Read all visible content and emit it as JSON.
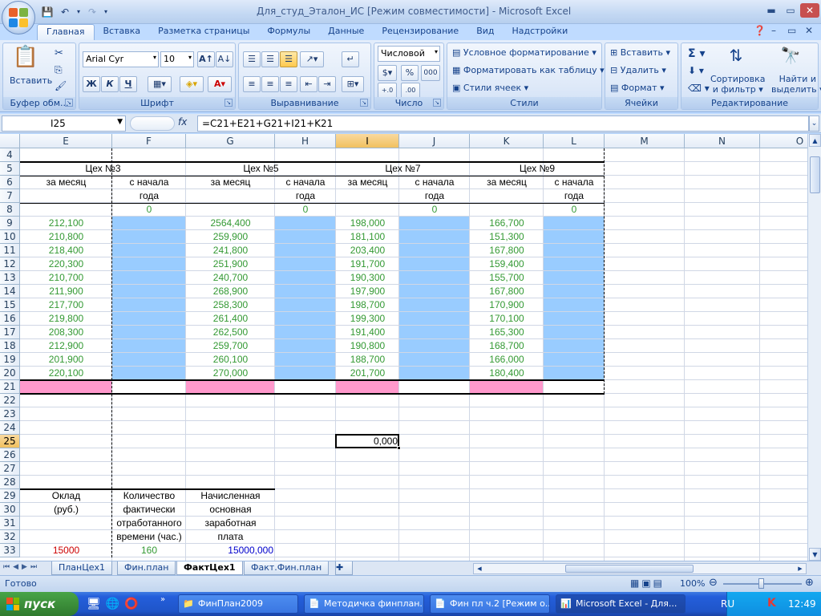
{
  "window": {
    "title": "Для_студ_Эталон_ИС  [Режим совместимости] - Microsoft Excel",
    "min": "▭",
    "close": "✕"
  },
  "ribbon_tabs": [
    "Главная",
    "Вставка",
    "Разметка страницы",
    "Формулы",
    "Данные",
    "Рецензирование",
    "Вид",
    "Надстройки"
  ],
  "groups": {
    "clipboard": {
      "label": "Буфер обм...",
      "paste": "Вставить"
    },
    "font": {
      "label": "Шрифт",
      "font_name": "Arial Cyr",
      "font_size": "10",
      "bold": "Ж",
      "italic": "К",
      "underline": "Ч"
    },
    "alignment": {
      "label": "Выравнивание"
    },
    "number": {
      "label": "Число",
      "format": "Числовой",
      "percent": "%",
      "thousands": "000"
    },
    "styles": {
      "label": "Стили",
      "cond_format": "Условное форматирование",
      "format_table": "Форматировать как таблицу",
      "cell_styles": "Стили ячеек"
    },
    "cells": {
      "label": "Ячейки",
      "insert": "Вставить",
      "delete": "Удалить",
      "format": "Формат"
    },
    "editing": {
      "label": "Редактирование",
      "sigma": "Σ",
      "sort_line1": "Сортировка",
      "sort_line2": "и фильтр",
      "find_line1": "Найти и",
      "find_line2": "выделить"
    }
  },
  "formula_bar": {
    "name_box": "I25",
    "fx": "fx",
    "formula": "=C21+E21+G21+I21+K21"
  },
  "columns": [
    {
      "letter": "E"
    },
    {
      "letter": "F"
    },
    {
      "letter": "G"
    },
    {
      "letter": "H"
    },
    {
      "letter": "I"
    },
    {
      "letter": "J"
    },
    {
      "letter": "K"
    },
    {
      "letter": "L"
    },
    {
      "letter": "M"
    },
    {
      "letter": "N"
    },
    {
      "letter": "O"
    }
  ],
  "rows": [
    "4",
    "5",
    "6",
    "7",
    "8",
    "9",
    "10",
    "11",
    "12",
    "13",
    "14",
    "15",
    "16",
    "17",
    "18",
    "19",
    "20",
    "21",
    "22",
    "23",
    "24",
    "25",
    "26",
    "27",
    "28",
    "29",
    "30",
    "31",
    "32",
    "33"
  ],
  "headers": {
    "shop3": "Цех №3",
    "shop5": "Цех №5",
    "shop7": "Цех №7",
    "shop9": "Цех №9",
    "per_month": "за месяц",
    "since_start_1": "с начала",
    "since_start_2": "года"
  },
  "row8_zeros": "0",
  "data": {
    "E": [
      "212,100",
      "210,800",
      "218,400",
      "220,300",
      "210,700",
      "211,900",
      "217,700",
      "219,800",
      "208,300",
      "212,900",
      "201,900",
      "220,100"
    ],
    "G": [
      "2564,400",
      "259,900",
      "241,800",
      "251,900",
      "240,700",
      "268,900",
      "258,300",
      "261,400",
      "262,500",
      "259,700",
      "260,100",
      "270,000"
    ],
    "I": [
      "198,000",
      "181,100",
      "203,400",
      "191,700",
      "190,300",
      "197,900",
      "198,700",
      "199,300",
      "191,400",
      "190,800",
      "188,700",
      "201,700"
    ],
    "K": [
      "166,700",
      "151,300",
      "167,800",
      "159,400",
      "155,700",
      "167,800",
      "170,900",
      "170,100",
      "165,300",
      "168,700",
      "166,000",
      "180,400"
    ]
  },
  "active_cell_value": "0,000",
  "salary": {
    "col1": [
      "Оклад",
      "(руб.)"
    ],
    "col2": [
      "Количество",
      "фактически",
      "отработанного",
      "времени (час.)"
    ],
    "col3": [
      "Начисленная",
      "основная",
      "заработная",
      "плата"
    ],
    "val1": "15000",
    "val2": "160",
    "val3": "15000,000"
  },
  "sheets": [
    "ПланЦех1",
    "Фин.план",
    "ФактЦех1",
    "Факт.Фин.план"
  ],
  "active_sheet": "ФактЦех1",
  "status": {
    "ready": "Готово",
    "zoom": "100%"
  },
  "taskbar": {
    "start": "пуск",
    "buttons": [
      "ФинПлан2009",
      "Методичка финплан...",
      "Фин пл ч.2 [Режим о...",
      "Microsoft Excel - Для..."
    ],
    "lang": "RU",
    "time": "12:49"
  },
  "colors": {
    "green": "#339933",
    "blue": "#0000cc",
    "red": "#cc0000",
    "fill_blue": "#99ccff",
    "fill_pink": "#ff99cc",
    "selected_header": "#f5c76a"
  }
}
